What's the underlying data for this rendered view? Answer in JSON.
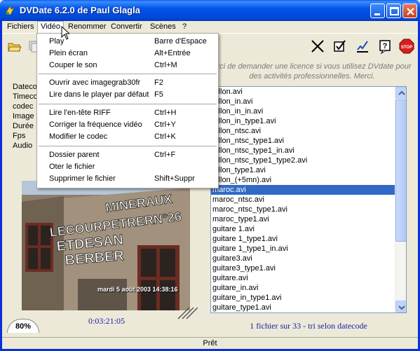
{
  "window": {
    "title": "DVDate 6.2.0 de Paul Glagla",
    "icon": "dvdate-app-icon"
  },
  "menubar": {
    "items": [
      "Fichiers",
      "Vidéo",
      "Renommer",
      "Convertir",
      "Scènes",
      "?"
    ],
    "open": "Vidéo"
  },
  "video_menu": {
    "groups": [
      [
        {
          "label": "Play",
          "shortcut": "Barre d'Espace"
        },
        {
          "label": "Plein écran",
          "shortcut": "Alt+Entrée"
        },
        {
          "label": "Couper le son",
          "shortcut": "Ctrl+M"
        }
      ],
      [
        {
          "label": "Ouvrir avec imagegrab30fr",
          "shortcut": "F2"
        },
        {
          "label": "Lire dans le player par défaut",
          "shortcut": "F5"
        }
      ],
      [
        {
          "label": "Lire l'en-tête RIFF",
          "shortcut": "Ctrl+H"
        },
        {
          "label": "Corriger la fréquence vidéo",
          "shortcut": "Ctrl+Y"
        },
        {
          "label": "Modifier le codec",
          "shortcut": "Ctrl+K"
        }
      ],
      [
        {
          "label": "Dossier parent",
          "shortcut": "Ctrl+F"
        },
        {
          "label": "Oter le fichier",
          "shortcut": ""
        },
        {
          "label": "Supprimer le fichier",
          "shortcut": "Shift+Suppr"
        }
      ]
    ]
  },
  "toolbar": {
    "icons": [
      "open-folder-icon",
      "copy-icon",
      "cross-tool-icon",
      "check-icon",
      "chart-check-icon",
      "help-icon",
      "stop-icon"
    ],
    "stop_label": "STOP",
    "help_label": "?"
  },
  "license_text": "erci de demander une licence si vous utilisez DVdate pour des activités professionnelles. Merci.",
  "info_labels": [
    "Dateco",
    "Timeco",
    "codec",
    "Image",
    "Durée",
    "Fps",
    "Audio"
  ],
  "files": {
    "items": [
      "aillon.avi",
      "aillon_in.avi",
      "aillon_in_in.avi",
      "aillon_in_type1.avi",
      "aillon_ntsc.avi",
      "aillon_ntsc_type1.avi",
      "aillon_ntsc_type1_in.avi",
      "aillon_ntsc_type1_type2.avi",
      "aillon_type1.avi",
      "aillon_(+5mn).avi",
      "maroc.avi",
      "maroc_ntsc.avi",
      "maroc_ntsc_type1.avi",
      "maroc_type1.avi",
      "guitare 1.avi",
      "guitare 1_type1.avi",
      "guitare 1_type1_in.avi",
      "guitare3.avi",
      "guitare3_type1.avi",
      "guitare.avi",
      "guitare_in.avi",
      "guitare_in_type1.avi",
      "guitare_type1.avi"
    ],
    "selected_index": 10,
    "summary": "1 fichier sur 33 - tri selon datecode"
  },
  "photo": {
    "sign_lines": [
      "MINERAUX",
      "LECOURPETRERN°26",
      "ETDESAN",
      "BERBER"
    ],
    "date_overlay": "mardi 5 août 2003 14:38:16"
  },
  "zoom": "80%",
  "timecode": "0:03:21:05",
  "status": "Prêt"
}
